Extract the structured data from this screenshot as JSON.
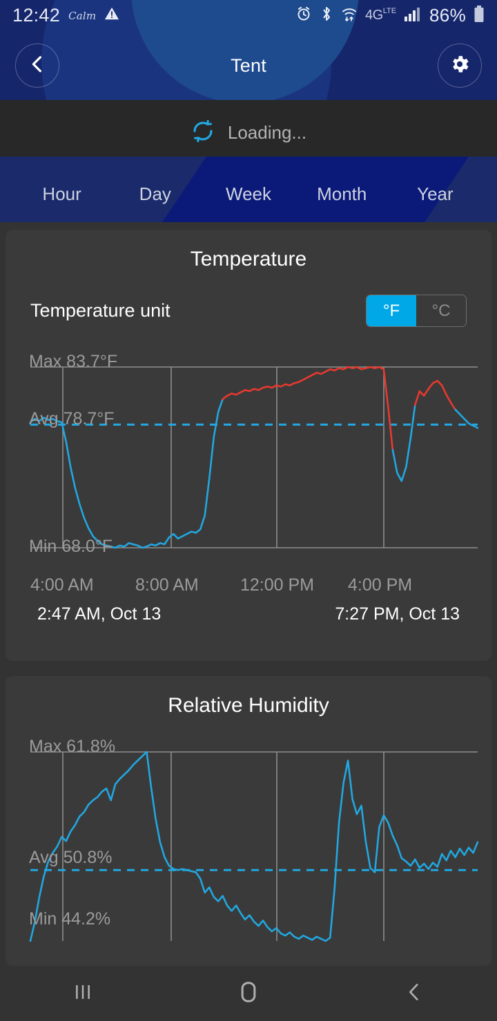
{
  "status_bar": {
    "clock": "12:42",
    "carrier_logo": "Calm",
    "warning_icon": "warning-triangle-icon",
    "alarm_icon": "alarm-clock-icon",
    "bluetooth_icon": "bluetooth-icon",
    "wifi_icon": "wifi-icon",
    "network_label": "4G",
    "network_sub": "LTE",
    "signal_icon": "signal-bars-icon",
    "battery_percent": "86%",
    "battery_icon": "battery-icon"
  },
  "app_bar": {
    "back_icon": "chevron-left-icon",
    "title": "Tent",
    "settings_icon": "gear-icon"
  },
  "loading": {
    "icon": "refresh-spinner-icon",
    "text": "Loading..."
  },
  "range_tabs": {
    "items": [
      {
        "label": "Hour"
      },
      {
        "label": "Day"
      },
      {
        "label": "Week"
      },
      {
        "label": "Month"
      },
      {
        "label": "Year"
      }
    ],
    "selected": "Day"
  },
  "temperature_card": {
    "title": "Temperature",
    "unit_label": "Temperature unit",
    "unit_options": [
      {
        "label": "°F",
        "selected": true
      },
      {
        "label": "°C",
        "selected": false
      }
    ],
    "max_label": "Max 83.7°F",
    "avg_label": "Avg 78.7°F",
    "min_label": "Min 68.0°F",
    "start_time": "2:47 AM,  Oct 13",
    "end_time": "7:27 PM,  Oct 13"
  },
  "humidity_card": {
    "title": "Relative Humidity",
    "max_label": "Max 61.8%",
    "avg_label": "Avg 50.8%",
    "min_label": "Min 44.2%"
  },
  "nav_bar": {
    "recents_icon": "recents-icon",
    "home_icon": "home-icon",
    "back_icon": "back-chevron-icon"
  },
  "colors": {
    "accent_cyan": "#22a7e0",
    "alert_red": "#e8392f",
    "header_navy": "#16266b",
    "card_bg": "#3a3a3a",
    "page_bg": "#333333",
    "toggle_active": "#00a8e8"
  },
  "chart_data": [
    {
      "type": "line",
      "title": "Temperature",
      "ylabel": "°F",
      "xlabel": "",
      "ylim": [
        68.0,
        83.7
      ],
      "axis_ticks": [
        "4:00 AM",
        "8:00 AM",
        "12:00 PM",
        "4:00 PM"
      ],
      "stats": {
        "max": 83.7,
        "avg": 78.7,
        "min": 68.0,
        "unit": "°F"
      },
      "avg_line": 78.7,
      "grid": true,
      "legend": "none",
      "threshold_color_above": "#e8392f",
      "series": [
        {
          "name": "Temperature",
          "x": [
            0,
            1,
            2,
            3,
            4,
            5,
            6,
            7,
            8,
            9,
            10,
            11,
            12,
            13,
            14,
            15,
            16,
            17,
            18,
            19,
            20,
            21,
            22,
            23,
            24,
            25,
            26,
            27,
            28,
            29,
            30,
            31,
            32,
            33,
            34,
            35,
            36,
            37,
            38,
            39,
            40,
            41,
            42,
            43,
            44,
            45,
            46,
            47,
            48,
            49,
            50,
            51,
            52,
            53,
            54,
            55,
            56,
            57,
            58,
            59,
            60,
            61,
            62,
            63,
            64,
            65,
            66,
            67,
            68,
            69,
            70,
            71,
            72,
            73,
            74,
            75,
            76,
            77,
            78,
            79,
            80,
            81,
            82,
            83,
            84,
            85,
            86,
            87,
            88,
            89,
            90,
            91,
            92,
            93,
            94,
            95,
            96,
            97,
            98,
            99,
            100
          ],
          "values": [
            78.9,
            79.2,
            79.0,
            79.3,
            79.1,
            79.2,
            79.0,
            78.9,
            77.2,
            75.0,
            73.2,
            71.8,
            70.6,
            69.7,
            69.0,
            68.6,
            68.3,
            68.2,
            68.1,
            68.0,
            68.2,
            68.1,
            68.4,
            68.3,
            68.2,
            68.0,
            68.1,
            68.3,
            68.2,
            68.4,
            68.3,
            68.9,
            69.2,
            68.8,
            69.0,
            69.2,
            69.4,
            69.3,
            69.6,
            70.8,
            74.0,
            77.6,
            79.8,
            80.9,
            81.2,
            81.4,
            81.3,
            81.5,
            81.7,
            81.6,
            81.8,
            81.7,
            81.9,
            82.0,
            81.9,
            82.1,
            82.0,
            82.2,
            82.1,
            82.3,
            82.4,
            82.6,
            82.8,
            83.0,
            83.2,
            83.1,
            83.3,
            83.5,
            83.4,
            83.6,
            83.5,
            83.7,
            83.6,
            83.7,
            83.5,
            83.6,
            83.7,
            83.6,
            83.7,
            83.5,
            80.2,
            76.5,
            74.5,
            73.8,
            75.0,
            77.5,
            80.4,
            81.6,
            81.2,
            81.8,
            82.3,
            82.5,
            82.1,
            81.3,
            80.6,
            80.0,
            79.6,
            79.2,
            78.8,
            78.6,
            78.4
          ]
        }
      ]
    },
    {
      "type": "line",
      "title": "Relative Humidity",
      "ylabel": "%",
      "xlabel": "",
      "ylim": [
        44.2,
        61.8
      ],
      "stats": {
        "max": 61.8,
        "avg": 50.8,
        "min": 44.2,
        "unit": "%"
      },
      "avg_line": 50.8,
      "grid": true,
      "legend": "none",
      "series": [
        {
          "name": "Relative Humidity",
          "x": [
            0,
            1,
            2,
            3,
            4,
            5,
            6,
            7,
            8,
            9,
            10,
            11,
            12,
            13,
            14,
            15,
            16,
            17,
            18,
            19,
            20,
            21,
            22,
            23,
            24,
            25,
            26,
            27,
            28,
            29,
            30,
            31,
            32,
            33,
            34,
            35,
            36,
            37,
            38,
            39,
            40,
            41,
            42,
            43,
            44,
            45,
            46,
            47,
            48,
            49,
            50,
            51,
            52,
            53,
            54,
            55,
            56,
            57,
            58,
            59,
            60,
            61,
            62,
            63,
            64,
            65,
            66,
            67,
            68,
            69,
            70,
            71,
            72,
            73,
            74,
            75,
            76,
            77,
            78,
            79,
            80,
            81,
            82,
            83,
            84,
            85,
            86,
            87,
            88,
            89,
            90,
            91,
            92,
            93,
            94,
            95,
            96,
            97,
            98,
            99,
            100
          ],
          "values": [
            44.2,
            46.0,
            48.3,
            50.2,
            51.6,
            52.4,
            53.0,
            53.9,
            53.5,
            54.4,
            55.0,
            55.8,
            56.2,
            56.9,
            57.3,
            57.6,
            58.1,
            58.4,
            57.3,
            58.8,
            59.3,
            59.7,
            60.1,
            60.6,
            61.0,
            61.4,
            61.8,
            58.5,
            55.6,
            53.4,
            52.0,
            51.2,
            50.9,
            50.8,
            50.9,
            50.8,
            50.7,
            50.6,
            50.0,
            48.7,
            49.2,
            48.3,
            47.9,
            48.4,
            47.5,
            47.0,
            47.5,
            46.8,
            46.2,
            46.6,
            46.0,
            45.6,
            46.1,
            45.5,
            45.1,
            45.4,
            44.9,
            44.7,
            45.0,
            44.6,
            44.4,
            44.7,
            44.5,
            44.3,
            44.6,
            44.4,
            44.2,
            44.5,
            49.0,
            55.2,
            58.9,
            61.0,
            57.4,
            56.0,
            56.8,
            53.4,
            51.0,
            50.6,
            54.8,
            55.9,
            55.2,
            54.0,
            53.1,
            51.9,
            51.6,
            51.2,
            51.8,
            51.0,
            51.4,
            50.9,
            51.5,
            51.1,
            52.3,
            51.7,
            52.6,
            52.0,
            52.8,
            52.2,
            52.9,
            52.4,
            53.4
          ]
        }
      ]
    }
  ]
}
